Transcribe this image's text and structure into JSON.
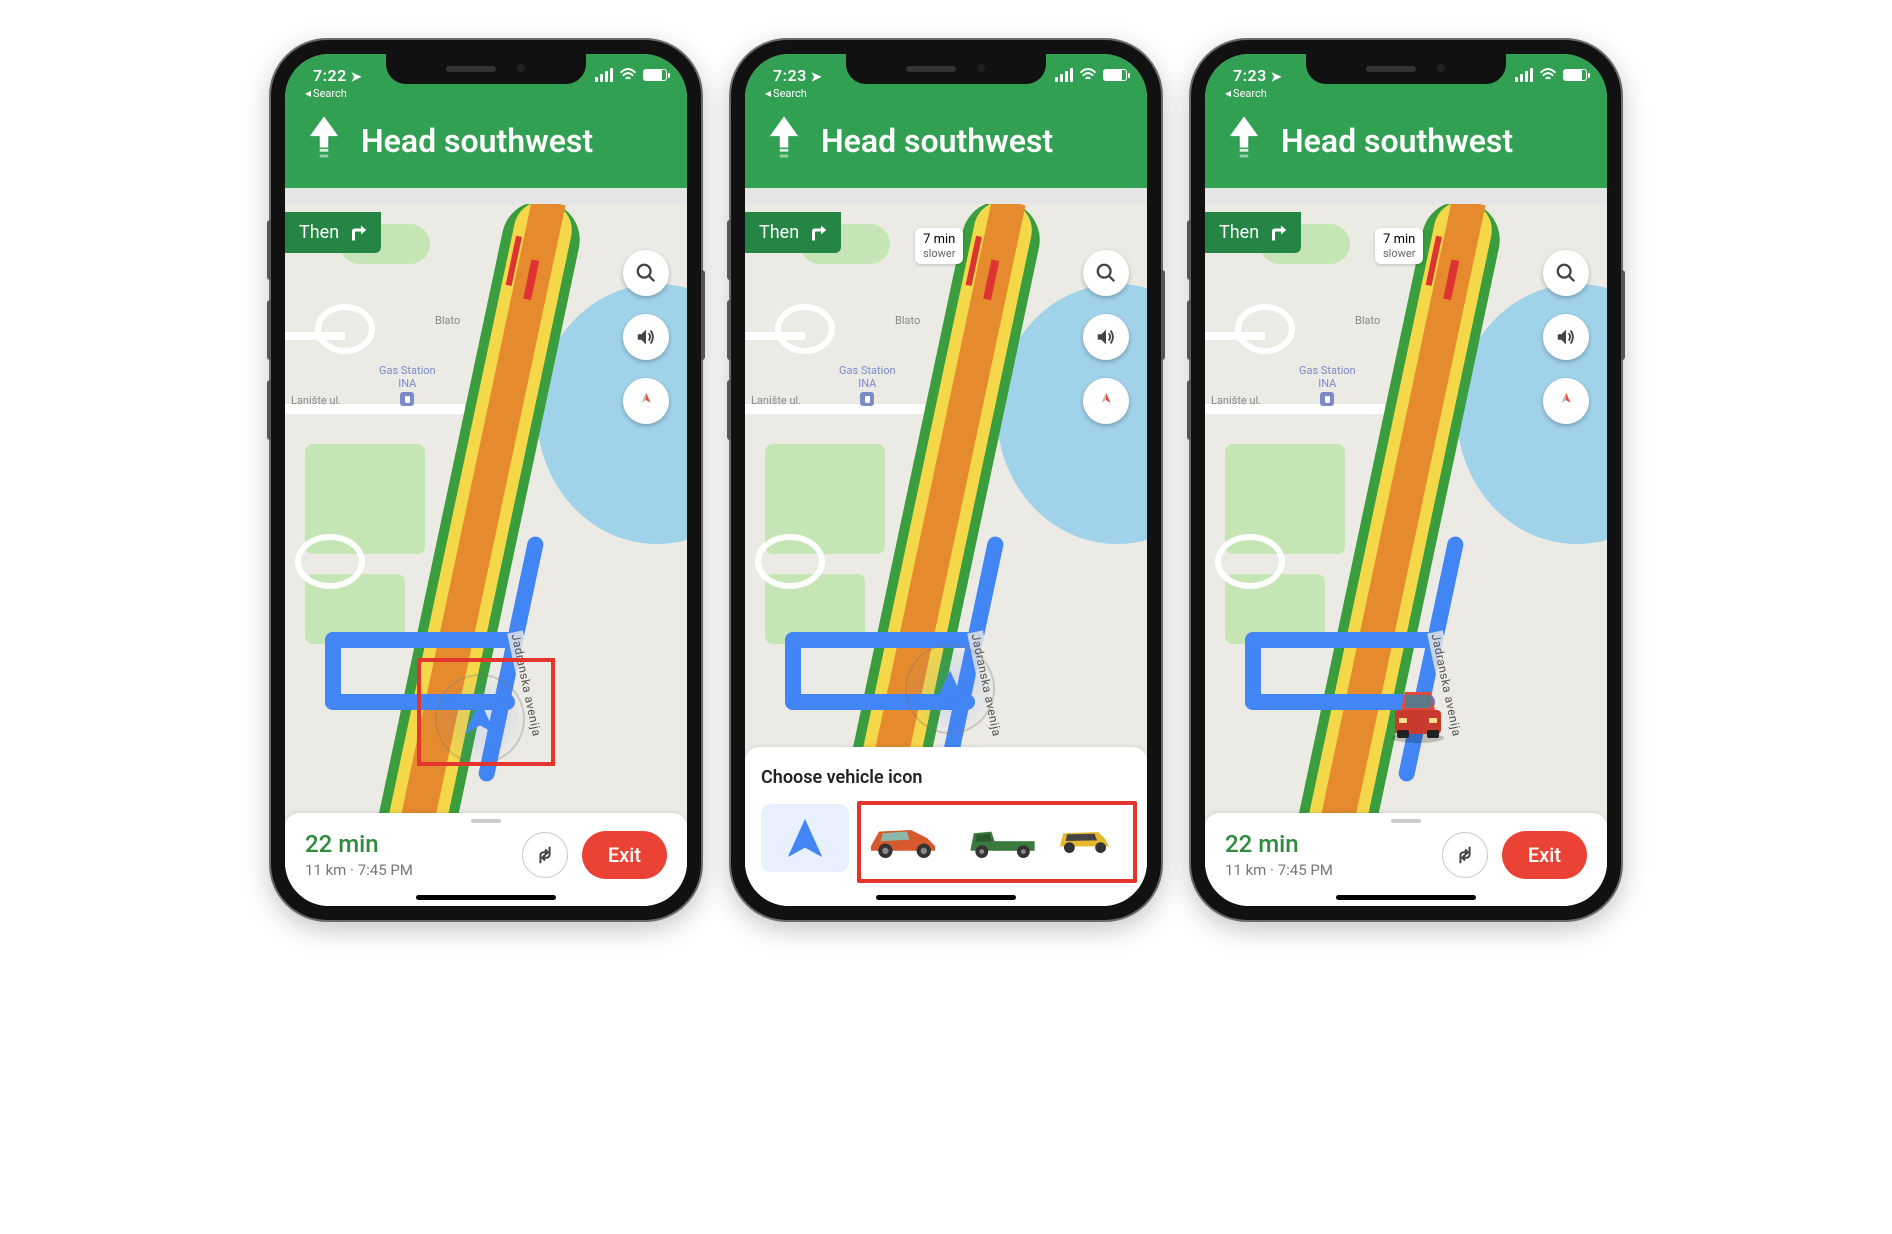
{
  "statusbar": {
    "back": "Search",
    "location_glyph": "➤"
  },
  "directions": {
    "heading": "Head southwest",
    "then_label": "Then"
  },
  "traffic": {
    "line1": "7 min",
    "line2": "slower"
  },
  "map_labels": {
    "street1": "Lanište ul.",
    "street2": "Blato",
    "poi_name": "Gas Station",
    "poi_sub": "INA",
    "route_road": "Jadranska avenija"
  },
  "bottom": {
    "eta_minutes": "22 min",
    "detail": "11 km · 7:45 PM",
    "exit_label": "Exit"
  },
  "choose": {
    "title": "Choose vehicle icon"
  },
  "phones": [
    {
      "time": "7:22",
      "show_traffic": false,
      "show_highlight_vehicle": true,
      "panel": "bottom",
      "vehicle": "arrow"
    },
    {
      "time": "7:23",
      "show_traffic": true,
      "panel": "choose"
    },
    {
      "time": "7:23",
      "show_traffic": true,
      "panel": "bottom",
      "vehicle": "redcar"
    }
  ],
  "colors": {
    "green": "#31a052",
    "blue": "#4285f4",
    "red": "#ea4335"
  }
}
